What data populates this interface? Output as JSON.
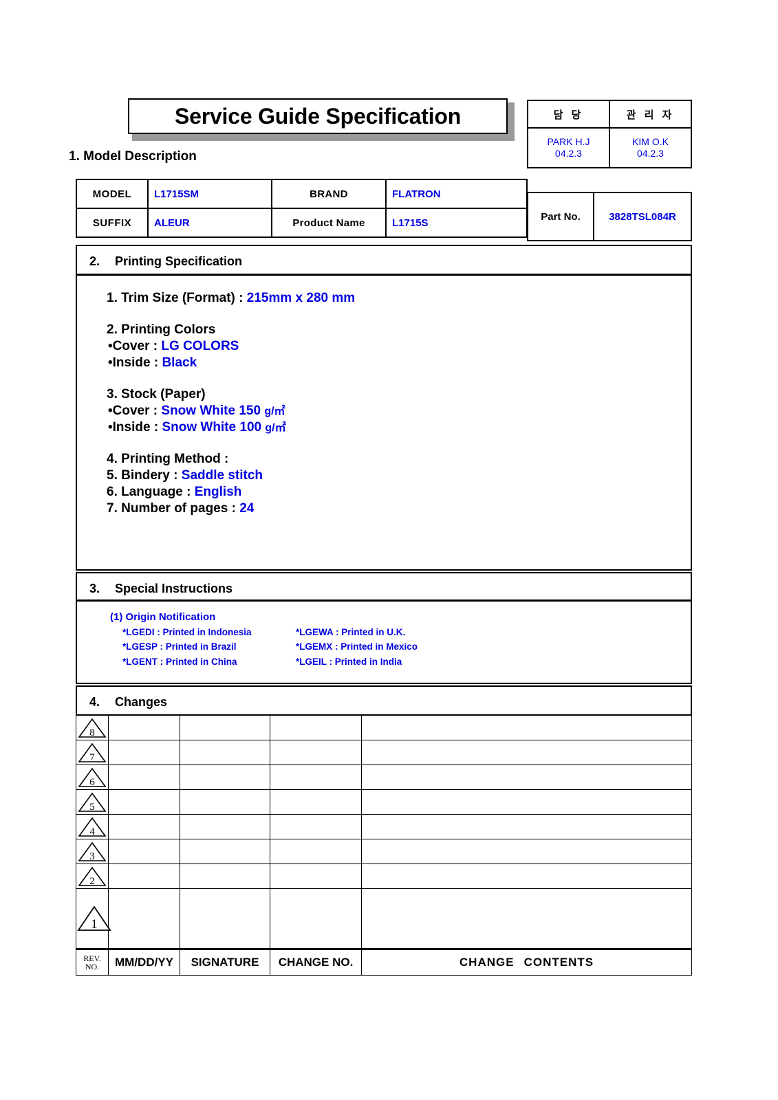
{
  "document": {
    "title": "Service Guide Specification"
  },
  "approval": {
    "headers": [
      "담  당",
      "관 리 자"
    ],
    "entries": [
      {
        "name": "PARK H.J",
        "date": "04.2.3"
      },
      {
        "name": "KIM O.K",
        "date": "04.2.3"
      }
    ]
  },
  "part": {
    "label": "Part No.",
    "value": "3828TSL084R"
  },
  "section1": {
    "heading": "1. Model Description",
    "fields": {
      "model_label": "MODEL",
      "model_value": "L1715SM",
      "brand_label": "BRAND",
      "brand_value": "FLATRON",
      "suffix_label": "SUFFIX",
      "suffix_value": "ALEUR",
      "product_name_label": "Product Name",
      "product_name_value": "L1715S"
    }
  },
  "section2": {
    "number": "2.",
    "heading": "Printing Specification",
    "trim_label": "1. Trim Size (Format) :",
    "trim_value": "215mm x 280 mm",
    "colors_heading": "2. Printing Colors",
    "colors_cover_label": "•Cover :",
    "colors_cover_value": "LG COLORS",
    "colors_inside_label": "•Inside :",
    "colors_inside_value": "Black",
    "stock_heading": "3. Stock (Paper)",
    "stock_cover_label": "•Cover :",
    "stock_cover_value": "Snow White 150",
    "stock_cover_unit": "g/㎡",
    "stock_inside_label": "•Inside :",
    "stock_inside_value": "Snow White 100",
    "stock_inside_unit": "g/㎡",
    "method_label": "4. Printing Method :",
    "bindery_label": "5. Bindery  :",
    "bindery_value": "Saddle stitch",
    "language_label": "6. Language :",
    "language_value": "English",
    "pages_label": "7. Number of pages :",
    "pages_value": "24"
  },
  "section3": {
    "number": "3.",
    "heading": "Special Instructions",
    "origin_title": "(1) Origin Notification",
    "origin_rows": [
      {
        "left": "*LGEDI : Printed in Indonesia",
        "right": "*LGEWA : Printed in U.K."
      },
      {
        "left": "*LGESP : Printed in Brazil",
        "right": "*LGEMX : Printed in Mexico"
      },
      {
        "left": "*LGENT : Printed in China",
        "right": "*LGEIL : Printed in India"
      }
    ]
  },
  "section4": {
    "number": "4.",
    "heading": "Changes",
    "revisions": [
      {
        "rev": "8",
        "date": "",
        "signature": "",
        "change_no": "",
        "contents": ""
      },
      {
        "rev": "7",
        "date": "",
        "signature": "",
        "change_no": "",
        "contents": ""
      },
      {
        "rev": "6",
        "date": "",
        "signature": "",
        "change_no": "",
        "contents": ""
      },
      {
        "rev": "5",
        "date": "",
        "signature": "",
        "change_no": "",
        "contents": ""
      },
      {
        "rev": "4",
        "date": "",
        "signature": "",
        "change_no": "",
        "contents": ""
      },
      {
        "rev": "3",
        "date": "",
        "signature": "",
        "change_no": "",
        "contents": ""
      },
      {
        "rev": "2",
        "date": "",
        "signature": "",
        "change_no": "",
        "contents": ""
      },
      {
        "rev": "1",
        "date": "",
        "signature": "",
        "change_no": "",
        "contents": ""
      }
    ],
    "footer": {
      "rev_line1": "REV.",
      "rev_line2": "NO.",
      "date": "MM/DD/YY",
      "signature": "SIGNATURE",
      "change_no": "CHANGE NO.",
      "contents_a": "CHANGE",
      "contents_b": "CONTENTS"
    }
  },
  "colors": {
    "accent_blue": "#0000e0",
    "ink_black": "#000000",
    "paper": "#ffffff"
  }
}
